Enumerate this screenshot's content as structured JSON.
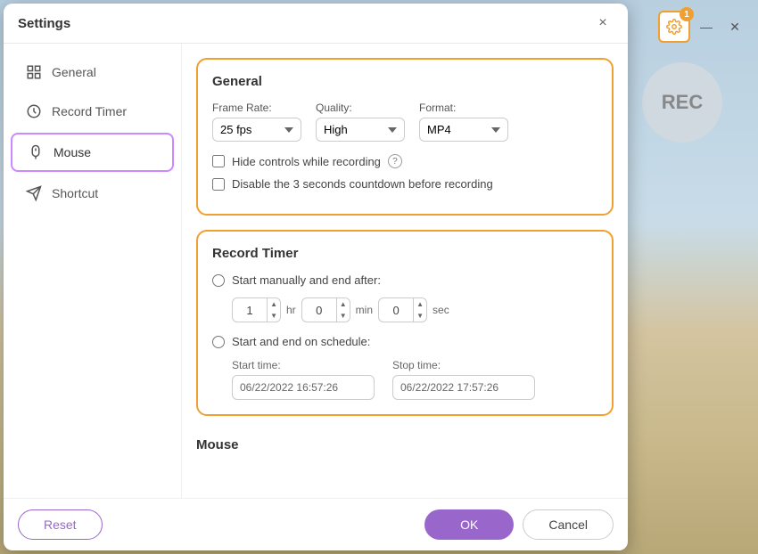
{
  "dialog": {
    "title": "Settings",
    "close_label": "×"
  },
  "sidebar": {
    "items": [
      {
        "id": "general",
        "label": "General",
        "icon": "📊",
        "active": false
      },
      {
        "id": "record-timer",
        "label": "Record Timer",
        "icon": "⏱",
        "active": false
      },
      {
        "id": "mouse",
        "label": "Mouse",
        "icon": "🖱",
        "active": true
      },
      {
        "id": "shortcut",
        "label": "Shortcut",
        "icon": "✈",
        "active": false
      }
    ]
  },
  "general_section": {
    "title": "General",
    "frame_rate_label": "Frame Rate:",
    "frame_rate_value": "25 fps",
    "quality_label": "Quality:",
    "quality_value": "High",
    "format_label": "Format:",
    "format_value": "MP4",
    "hide_controls_label": "Hide controls while recording",
    "disable_countdown_label": "Disable the 3 seconds countdown before recording"
  },
  "record_timer_section": {
    "title": "Record Timer",
    "start_manually_label": "Start manually and end after:",
    "timer_hr_value": "1",
    "timer_hr_unit": "hr",
    "timer_min_value": "0",
    "timer_min_unit": "min",
    "timer_sec_value": "0",
    "timer_sec_unit": "sec",
    "schedule_label": "Start and end on schedule:",
    "start_time_label": "Start time:",
    "start_time_value": "06/22/2022 16:57:26",
    "stop_time_label": "Stop time:",
    "stop_time_value": "06/22/2022 17:57:26"
  },
  "mouse_section": {
    "title": "Mouse"
  },
  "footer": {
    "reset_label": "Reset",
    "ok_label": "OK",
    "cancel_label": "Cancel"
  },
  "floating_panel": {
    "badge_count": "1",
    "minimize_label": "—",
    "close_label": "✕",
    "rec_label": "REC"
  }
}
